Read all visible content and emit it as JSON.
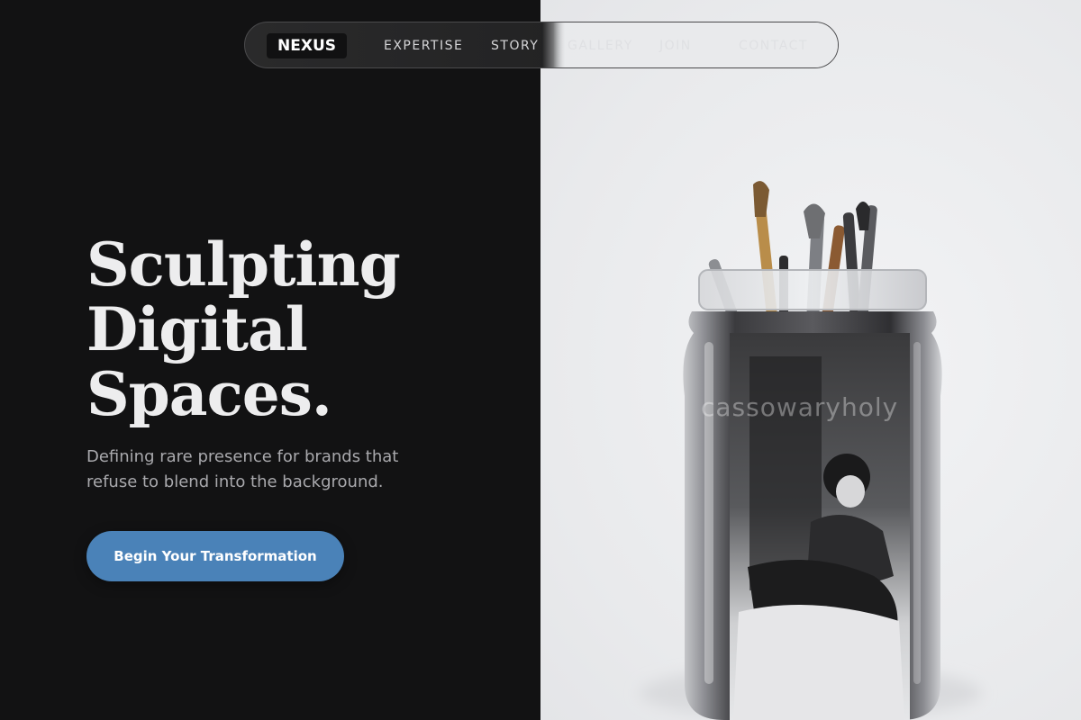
{
  "nav": {
    "brand": "NEXUS",
    "links": [
      "EXPERTISE",
      "STORY",
      "GALLERY",
      "JOIN",
      "CONTACT"
    ]
  },
  "hero": {
    "headline_lines": [
      "Sculpting",
      "Digital",
      "Spaces."
    ],
    "subtitle": "Defining rare presence for brands that refuse to blend into the background.",
    "cta_label": "Begin Your Transformation"
  },
  "image": {
    "watermark": "cassowaryholy"
  },
  "colors": {
    "background_dark": "#121213",
    "accent": "#4a82b8",
    "right_panel": "#e9eaec"
  }
}
